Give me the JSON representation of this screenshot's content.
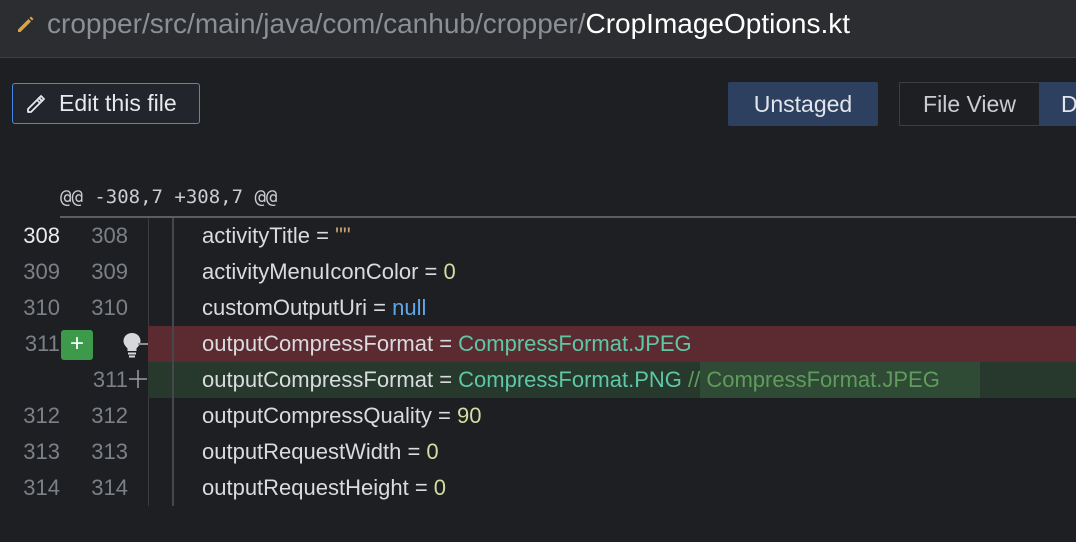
{
  "header": {
    "path_dir": "cropper/src/main/java/com/canhub/cropper/",
    "path_file": "CropImageOptions.kt",
    "icon": "pencil-icon"
  },
  "toolbar": {
    "edit_label": "Edit this file",
    "edit_icon": "pencil-icon",
    "unstaged_label": "Unstaged",
    "file_view_label": "File View",
    "diff_label": "D"
  },
  "diff": {
    "hunk_header": "@@ -308,7 +308,7 @@",
    "rows": [
      {
        "old": "308",
        "new": "308",
        "prefix": "activityTitle = ",
        "value": "\"\"",
        "value_type": "str",
        "suffix": ""
      },
      {
        "old": "309",
        "new": "309",
        "prefix": "activityMenuIconColor = ",
        "value": "0",
        "value_type": "num",
        "suffix": ""
      },
      {
        "old": "310",
        "new": "310",
        "prefix": "customOutputUri = ",
        "value": "null",
        "value_type": "kw",
        "suffix": ""
      },
      {
        "old": "311",
        "new": "",
        "prefix": "outputCompressFormat = ",
        "value": "CompressFormat.JPEG",
        "value_type": "cls",
        "suffix": "",
        "kind": "removed"
      },
      {
        "old": "",
        "new": "311",
        "prefix": "outputCompressFormat = ",
        "value": "CompressFormat.PNG",
        "value_type": "cls",
        "suffix": " // CompressFormat.JPEG",
        "kind": "added"
      },
      {
        "old": "312",
        "new": "312",
        "prefix": "outputCompressQuality = ",
        "value": "90",
        "value_type": "num",
        "suffix": ""
      },
      {
        "old": "313",
        "new": "313",
        "prefix": "outputRequestWidth = ",
        "value": "0",
        "value_type": "num",
        "suffix": ""
      },
      {
        "old": "314",
        "new": "314",
        "prefix": "outputRequestHeight = ",
        "value": "0",
        "value_type": "num",
        "suffix": ""
      }
    ],
    "add_button_label": "+",
    "colors": {
      "removed_bg": "#5c2b31",
      "added_bg": "#27382c",
      "accent": "#4a86e8",
      "add_button": "#3d9a4a"
    }
  }
}
